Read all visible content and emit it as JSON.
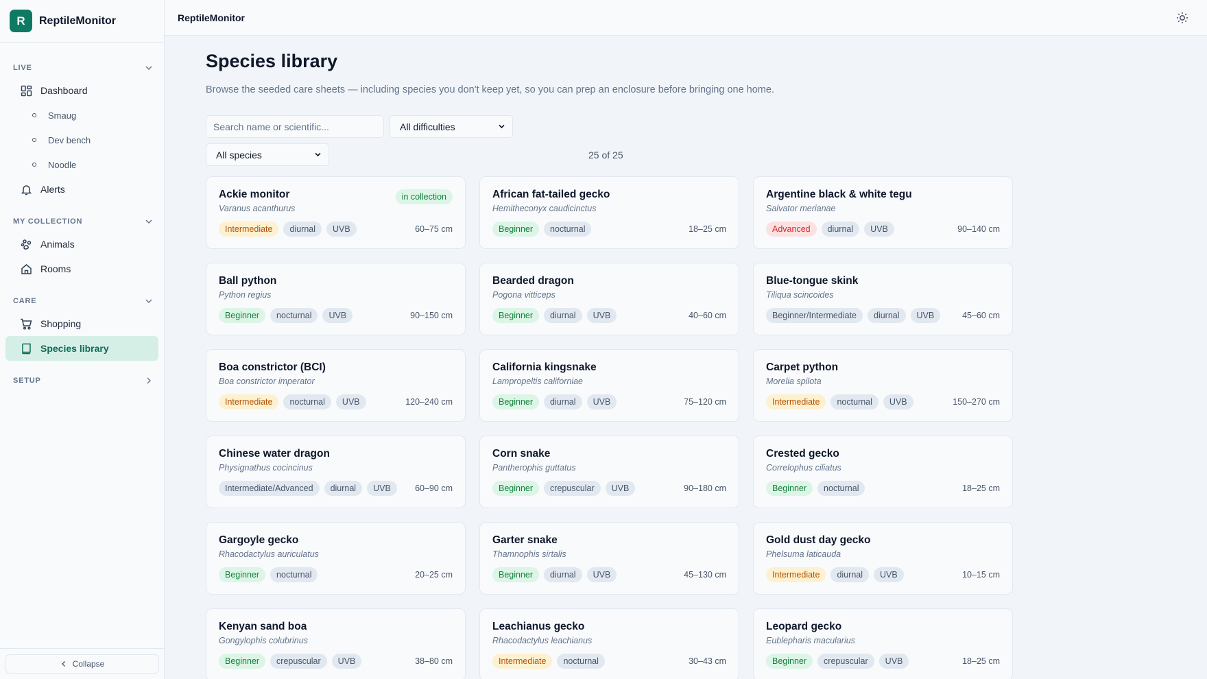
{
  "app": {
    "logo_letter": "R",
    "name": "ReptileMonitor"
  },
  "topbar": {
    "title": "ReptileMonitor",
    "theme_icon": "sun-icon"
  },
  "sidebar": {
    "live_label": "LIVE",
    "dashboard_label": "Dashboard",
    "animals_sub": [
      "Smaug",
      "Dev bench",
      "Noodle"
    ],
    "alerts_label": "Alerts",
    "collection_label": "MY COLLECTION",
    "animals_label": "Animals",
    "rooms_label": "Rooms",
    "care_label": "CARE",
    "shopping_label": "Shopping",
    "species_label": "Species library",
    "setup_label": "SETUP",
    "collapse_label": "Collapse"
  },
  "main": {
    "title": "Species library",
    "description": "Browse the seeded care sheets — including species you don't keep yet, so you can prep an enclosure before bringing one home.",
    "search_placeholder": "Search name or scientific...",
    "difficulty_select": "All difficulties",
    "species_select": "All species",
    "count": "25 of 25",
    "in_collection_label": "in collection"
  },
  "species": [
    {
      "name": "Ackie monitor",
      "sci": "Varanus acanthurus",
      "difficulty": "Intermediate",
      "diff_class": "intermediate",
      "activity": "diurnal",
      "uvb": "UVB",
      "size": "60–75 cm",
      "in_collection": true
    },
    {
      "name": "African fat-tailed gecko",
      "sci": "Hemitheconyx caudicinctus",
      "difficulty": "Beginner",
      "diff_class": "beginner",
      "activity": "nocturnal",
      "uvb": "",
      "size": "18–25 cm"
    },
    {
      "name": "Argentine black & white tegu",
      "sci": "Salvator merianae",
      "difficulty": "Advanced",
      "diff_class": "advanced",
      "activity": "diurnal",
      "uvb": "UVB",
      "size": "90–140 cm"
    },
    {
      "name": "Ball python",
      "sci": "Python regius",
      "difficulty": "Beginner",
      "diff_class": "beginner",
      "activity": "nocturnal",
      "uvb": "UVB",
      "size": "90–150 cm"
    },
    {
      "name": "Bearded dragon",
      "sci": "Pogona vitticeps",
      "difficulty": "Beginner",
      "diff_class": "beginner",
      "activity": "diurnal",
      "uvb": "UVB",
      "size": "40–60 cm"
    },
    {
      "name": "Blue-tongue skink",
      "sci": "Tiliqua scincoides",
      "difficulty": "Beginner/Intermediate",
      "diff_class": "mixed",
      "activity": "diurnal",
      "uvb": "UVB",
      "size": "45–60 cm"
    },
    {
      "name": "Boa constrictor (BCI)",
      "sci": "Boa constrictor imperator",
      "difficulty": "Intermediate",
      "diff_class": "intermediate",
      "activity": "nocturnal",
      "uvb": "UVB",
      "size": "120–240 cm"
    },
    {
      "name": "California kingsnake",
      "sci": "Lampropeltis californiae",
      "difficulty": "Beginner",
      "diff_class": "beginner",
      "activity": "diurnal",
      "uvb": "UVB",
      "size": "75–120 cm"
    },
    {
      "name": "Carpet python",
      "sci": "Morelia spilota",
      "difficulty": "Intermediate",
      "diff_class": "intermediate",
      "activity": "nocturnal",
      "uvb": "UVB",
      "size": "150–270 cm"
    },
    {
      "name": "Chinese water dragon",
      "sci": "Physignathus cocincinus",
      "difficulty": "Intermediate/Advanced",
      "diff_class": "mixed",
      "activity": "diurnal",
      "uvb": "UVB",
      "size": "60–90 cm"
    },
    {
      "name": "Corn snake",
      "sci": "Pantherophis guttatus",
      "difficulty": "Beginner",
      "diff_class": "beginner",
      "activity": "crepuscular",
      "uvb": "UVB",
      "size": "90–180 cm"
    },
    {
      "name": "Crested gecko",
      "sci": "Correlophus ciliatus",
      "difficulty": "Beginner",
      "diff_class": "beginner",
      "activity": "nocturnal",
      "uvb": "",
      "size": "18–25 cm"
    },
    {
      "name": "Gargoyle gecko",
      "sci": "Rhacodactylus auriculatus",
      "difficulty": "Beginner",
      "diff_class": "beginner",
      "activity": "nocturnal",
      "uvb": "",
      "size": "20–25 cm"
    },
    {
      "name": "Garter snake",
      "sci": "Thamnophis sirtalis",
      "difficulty": "Beginner",
      "diff_class": "beginner",
      "activity": "diurnal",
      "uvb": "UVB",
      "size": "45–130 cm"
    },
    {
      "name": "Gold dust day gecko",
      "sci": "Phelsuma laticauda",
      "difficulty": "Intermediate",
      "diff_class": "intermediate",
      "activity": "diurnal",
      "uvb": "UVB",
      "size": "10–15 cm"
    },
    {
      "name": "Kenyan sand boa",
      "sci": "Gongylophis colubrinus",
      "difficulty": "Beginner",
      "diff_class": "beginner",
      "activity": "crepuscular",
      "uvb": "UVB",
      "size": "38–80 cm"
    },
    {
      "name": "Leachianus gecko",
      "sci": "Rhacodactylus leachianus",
      "difficulty": "Intermediate",
      "diff_class": "intermediate",
      "activity": "nocturnal",
      "uvb": "",
      "size": "30–43 cm"
    },
    {
      "name": "Leopard gecko",
      "sci": "Eublepharis macularius",
      "difficulty": "Beginner",
      "diff_class": "beginner",
      "activity": "crepuscular",
      "uvb": "UVB",
      "size": "18–25 cm"
    }
  ]
}
